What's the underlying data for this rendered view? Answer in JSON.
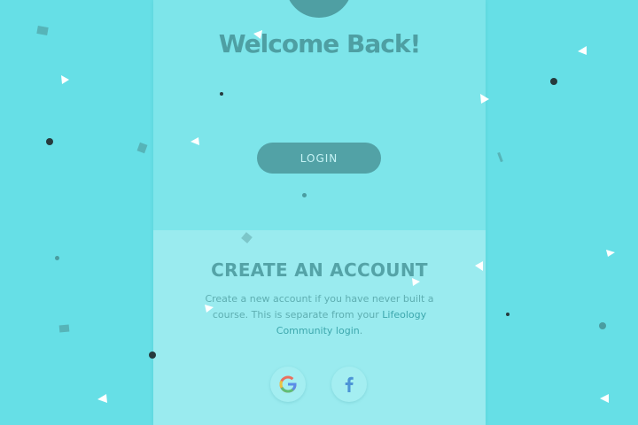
{
  "page": {
    "welcome_title": "Welcome Back!",
    "login_label": "LOGIN"
  },
  "account": {
    "title": "CREATE AN ACCOUNT",
    "description_prefix": "Create a new account if you have never built a course. This is separate from your ",
    "description_link": "Lifeology Community login",
    "description_suffix": "."
  },
  "social": {
    "google_icon": "google-icon",
    "facebook_icon": "facebook-icon"
  },
  "colors": {
    "background": "#66dfe6",
    "panel": "#7de5ea",
    "panel_bottom": "#9aebef",
    "accent": "#4f9fa3"
  }
}
